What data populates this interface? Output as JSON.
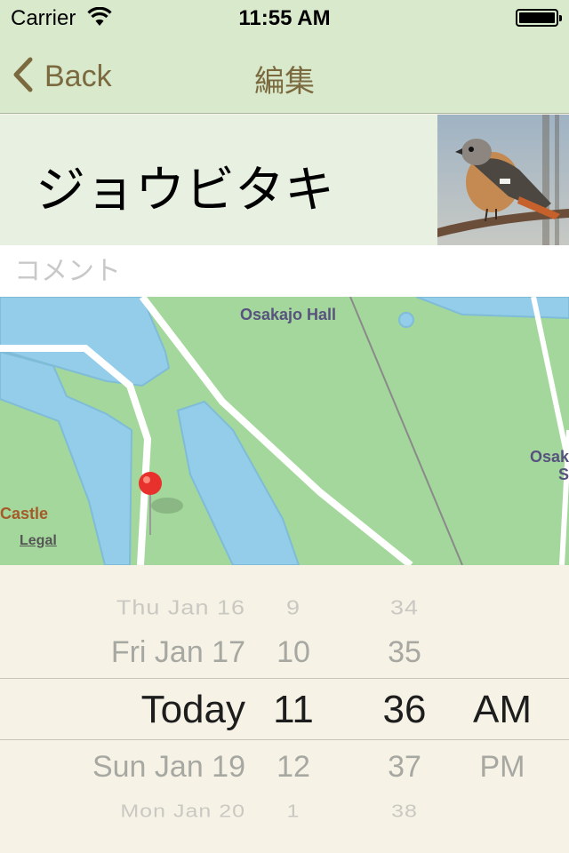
{
  "status_bar": {
    "carrier": "Carrier",
    "time": "11:55 AM"
  },
  "nav": {
    "back_label": "Back",
    "title": "編集"
  },
  "entry": {
    "bird_name": "ジョウビタキ",
    "comment_placeholder": "コメント",
    "comment_value": ""
  },
  "map": {
    "labels": {
      "hall": "Osakajo Hall",
      "castle": "Castle",
      "legal": "Legal",
      "edge_1": "Osak",
      "edge_2": "S"
    }
  },
  "picker": {
    "dates": [
      "Thu Jan 16",
      "Fri Jan 17",
      "Today",
      "Sun Jan 19",
      "Mon Jan 20"
    ],
    "hours": [
      "9",
      "10",
      "11",
      "12",
      "1"
    ],
    "minutes": [
      "34",
      "35",
      "36",
      "37",
      "38"
    ],
    "ampm": [
      "",
      "",
      "AM",
      "PM",
      ""
    ]
  },
  "colors": {
    "bar_bg": "#d9e9cc",
    "tint": "#7b6a3f",
    "name_row_bg": "#e8f1e1",
    "picker_bg": "#f6f3e6",
    "pin": "#e8302d"
  }
}
